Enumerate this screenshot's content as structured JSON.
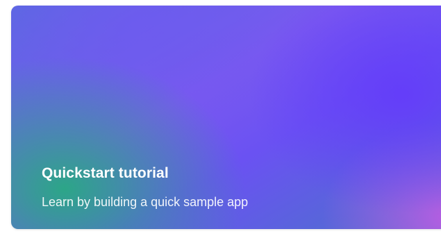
{
  "card": {
    "title": "Quickstart tutorial",
    "subtitle": "Learn by building a quick sample app",
    "colors": {
      "gradient_teal": "#28aa82",
      "gradient_violet": "#643cfa",
      "gradient_indigo": "#5a6ae0",
      "gradient_pink": "#c85ae6",
      "text": "#ffffff"
    }
  }
}
